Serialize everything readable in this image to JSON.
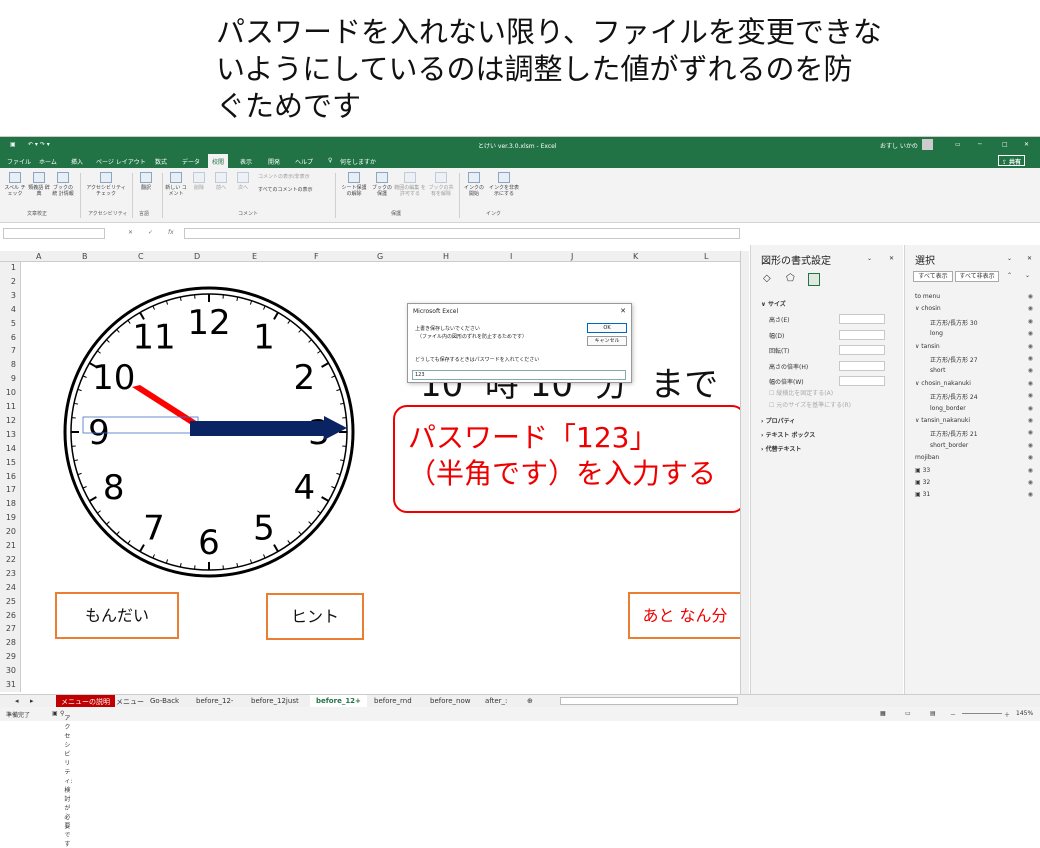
{
  "heading": [
    "パスワードを入れない限り、ファイルを変更できな",
    "いようにしているのは調整した値がずれるのを防",
    "ぐためです"
  ],
  "window": {
    "filename": "とけい ver.3.0.xlsm  -  Excel",
    "user": "おすし いかの"
  },
  "menu": [
    "ファイル",
    "ホーム",
    "挿入",
    "ページ レイアウト",
    "数式",
    "データ",
    "校閲",
    "表示",
    "開発",
    "ヘルプ",
    "何をしますか"
  ],
  "share_label": "共有",
  "ribbon": {
    "items": [
      "スペル チェック",
      "類義語 辞典",
      "ブックの統 計情報",
      "アクセシビリティ チェック",
      "翻訳",
      "新しい コメント",
      "削除",
      "前へ",
      "次へ",
      "シート保護 の解除",
      "ブックの 保護",
      "範囲の編集 を許可する",
      "ブックの共 有を解除",
      "インクの 開始",
      "インクを非表 示にする"
    ],
    "comment_opts": [
      "コメントの表示/非表示",
      "すべてのコメントの表示"
    ],
    "groups": [
      "文章校正",
      "アクセシビリティ",
      "言語",
      "コメント",
      "保護",
      "インク"
    ]
  },
  "columns": [
    "A",
    "B",
    "C",
    "D",
    "E",
    "F",
    "G",
    "H",
    "I",
    "J",
    "K",
    "L"
  ],
  "clock_numbers": [
    "12",
    "1",
    "2",
    "3",
    "4",
    "5",
    "6",
    "7",
    "8",
    "9",
    "10",
    "11"
  ],
  "dialog": {
    "title": "Microsoft Excel",
    "line1": "上書き保存しないでください",
    "line2": "（ファイル内の図形のずれを防止するためです）",
    "line3": "どうしても保存するときはパスワードを入れてください",
    "ok": "OK",
    "cancel": "キャンセル",
    "input_value": "123"
  },
  "bigtext": {
    "hour": "10",
    "ji": "時",
    "min": "10",
    "fun": "分",
    "made": "まで"
  },
  "callout": [
    "パスワード「123」",
    "（半角です）を入力する"
  ],
  "buttons": {
    "mondai": "もんだい",
    "hint": "ヒント",
    "ato": "あと なん分"
  },
  "format_pane": {
    "title": "図形の書式設定",
    "section": "サイズ",
    "fields": [
      "高さ(E)",
      "幅(D)",
      "回転(T)",
      "高さの倍率(H)",
      "幅の倍率(W)"
    ],
    "checks": [
      "縦横比を固定する(A)",
      "元のサイズを基準にする(R)"
    ],
    "links": [
      "プロパティ",
      "テキスト ボックス",
      "代替テキスト"
    ]
  },
  "select_pane": {
    "title": "選択",
    "show_all": "すべて表示",
    "hide_all": "すべて非表示",
    "items": [
      "to menu",
      "chosin",
      "正方形/長方形 30",
      "long",
      "tansin",
      "正方形/長方形 27",
      "short",
      "chosin_nakanuki",
      "正方形/長方形 24",
      "long_border",
      "tansin_nakanuki",
      "正方形/長方形 21",
      "short_border",
      "mojiban",
      "33",
      "32",
      "31"
    ]
  },
  "sheet_tabs": [
    "メニューの説明",
    "メニュー",
    "Go-Back",
    "before_12-",
    "before_12just",
    "before_12+",
    "before_rnd",
    "before_now",
    "after_:"
  ],
  "status": {
    "ready": "準備完了",
    "access": "アクセシビリティ: 検討が必要です",
    "zoom": "145%"
  },
  "colors": {
    "excel_green": "#217346",
    "callout_red": "#e00000",
    "hand_navy": "#0a2463",
    "hand_red": "#ff0000",
    "box_orange": "#ed7d31"
  }
}
